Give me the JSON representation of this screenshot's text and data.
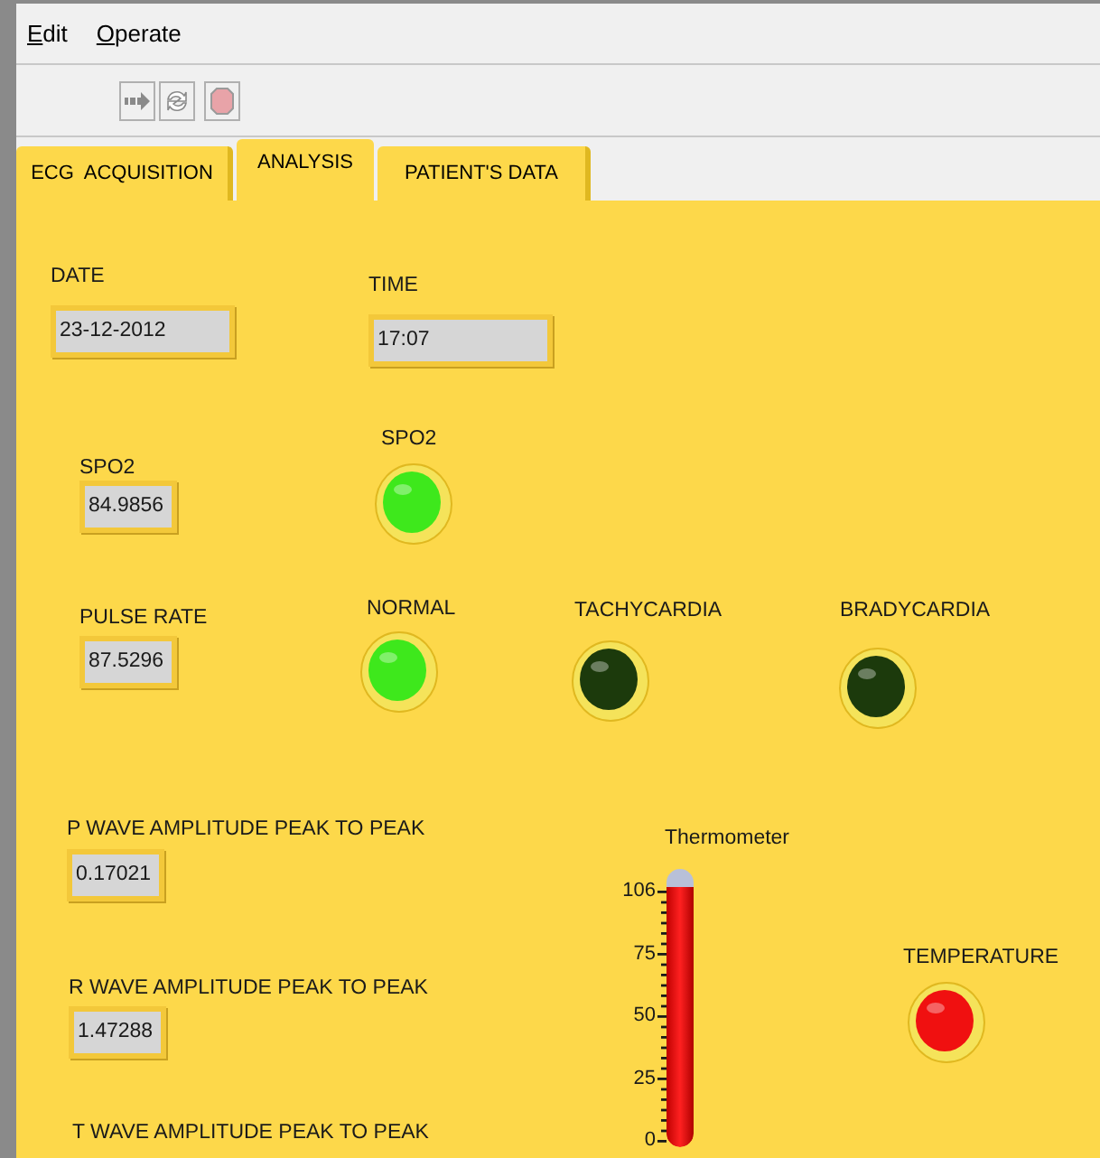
{
  "menu": [
    "Edit",
    "Operate"
  ],
  "tabs": [
    {
      "label": "ECG  ACQUISITION",
      "selected": false
    },
    {
      "label": "ANALYSIS",
      "selected": true
    },
    {
      "label": "PATIENT'S DATA",
      "selected": false
    }
  ],
  "indicators": [
    {
      "label": "DATE",
      "value": "23-12-2012"
    },
    {
      "label": "TIME",
      "value": "17:07"
    },
    {
      "label": "SPO2",
      "value": "84.9856"
    },
    {
      "label": "PULSE RATE",
      "value": "87.5296"
    },
    {
      "label": "P WAVE AMPLITUDE PEAK TO PEAK",
      "value": "0.17021"
    },
    {
      "label": "R WAVE AMPLITUDE PEAK TO PEAK",
      "value": "1.47288"
    },
    {
      "label": "T WAVE AMPLITUDE PEAK TO PEAK"
    }
  ],
  "leds": [
    {
      "label": "SPO2",
      "on": true,
      "kind": "green"
    },
    {
      "label": "NORMAL",
      "on": true,
      "kind": "green"
    },
    {
      "label": "TACHYCARDIA",
      "on": false,
      "kind": "green"
    },
    {
      "label": "BRADYCARDIA",
      "on": false,
      "kind": "green"
    },
    {
      "label": "TEMPERATURE",
      "on": true,
      "kind": "red"
    }
  ],
  "thermometer": {
    "label": "Thermometer",
    "ticks": [
      "106",
      "75",
      "50",
      "25",
      "0"
    ]
  }
}
